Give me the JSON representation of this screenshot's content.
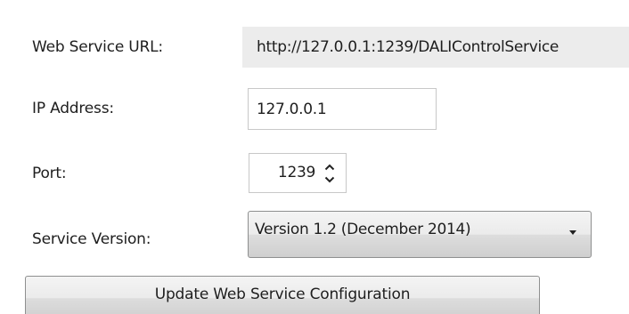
{
  "form": {
    "url_label": "Web Service URL:",
    "url_value": "http://127.0.0.1:1239/DALIControlService",
    "ip_label": "IP Address:",
    "ip_value": "127.0.0.1",
    "port_label": "Port:",
    "port_value": "1239",
    "version_label": "Service Version:",
    "version_value": "Version 1.2 (December 2014)",
    "update_button_label": "Update Web Service Configuration"
  },
  "icons": {
    "spinner_up": "chevron-up-icon",
    "spinner_down": "chevron-down-icon",
    "dropdown_arrow": "triangle-down-icon"
  },
  "colors": {
    "readonly_field_bg": "#ececec",
    "input_border": "#c8c8c8",
    "button_border": "#8e8f8f"
  }
}
